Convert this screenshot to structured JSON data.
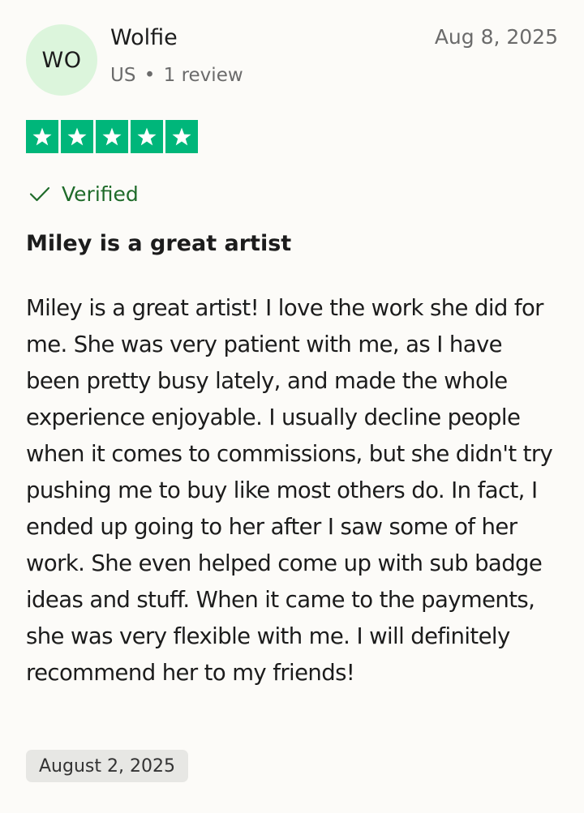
{
  "reviewer": {
    "initials": "WO",
    "name": "Wolfie",
    "country": "US",
    "separator": "•",
    "review_count": "1 review"
  },
  "review": {
    "date": "Aug 8, 2025",
    "rating": 5,
    "rating_max": 5,
    "verified_label": "Verified",
    "title": "Miley is a great artist",
    "body": "Miley is a great artist! I love the work she did for me. She was very patient with me, as I have been pretty busy lately, and made the whole experience enjoyable. I usually decline people when it comes to commissions, but she didn't try pushing me to buy like most others do. In fact, I ended up going to her after I saw some of her work. She even helped come up with sub badge ideas and stuff. When it came to the payments, she was very flexible with me. I will definitely recommend her to my friends!",
    "experience_date": "August 2, 2025"
  },
  "colors": {
    "star_green": "#00b67a",
    "avatar_bg": "#dcf5dc",
    "verified_green": "#1f6b2a",
    "date_chip_bg": "#e7e7e4"
  },
  "icons": {
    "star": "star-icon",
    "verified": "checkmark-icon"
  }
}
